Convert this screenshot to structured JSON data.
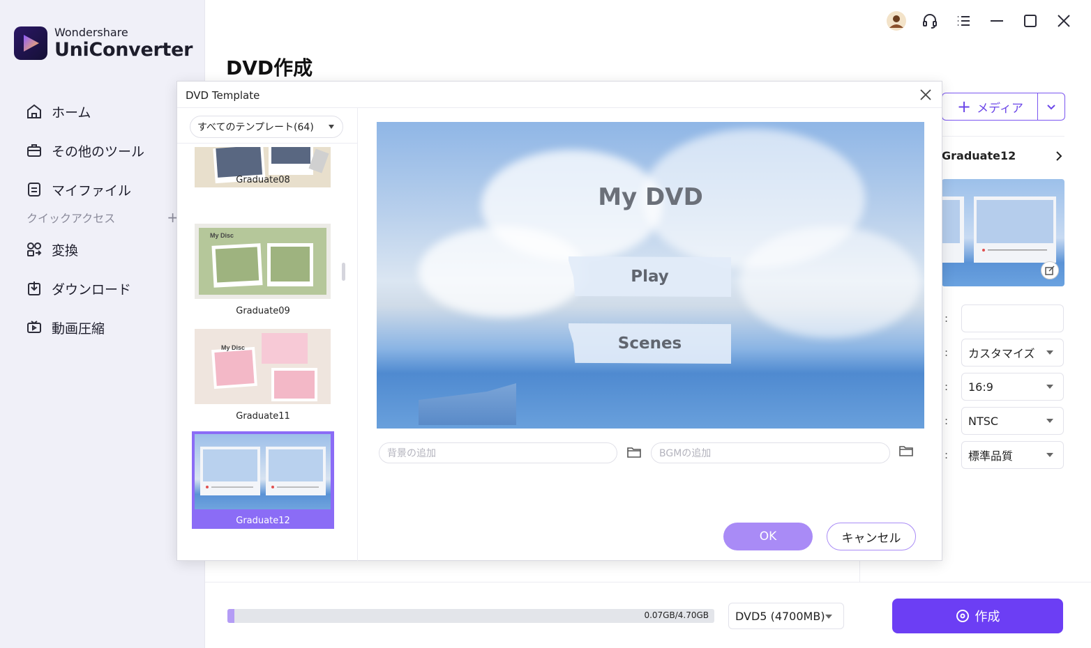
{
  "app": {
    "brand_small": "Wondershare",
    "brand_big": "UniConverter"
  },
  "sidebar": {
    "items": [
      {
        "label": "ホーム",
        "icon": "home-icon"
      },
      {
        "label": "その他のツール",
        "icon": "toolbox-icon"
      },
      {
        "label": "マイファイル",
        "icon": "file-icon"
      }
    ],
    "quick_access_label": "クイックアクセス",
    "quick_items": [
      {
        "label": "変換",
        "icon": "convert-icon"
      },
      {
        "label": "ダウンロード",
        "icon": "download-icon"
      },
      {
        "label": "動画圧縮",
        "icon": "compress-icon"
      }
    ]
  },
  "page": {
    "title": "DVD作成"
  },
  "right_panel": {
    "media_label": "メディア",
    "template_name": "Graduate12",
    "settings": [
      {
        "value": ""
      },
      {
        "value": "カスタマイズ"
      },
      {
        "value": "16:9"
      },
      {
        "value": "NTSC"
      },
      {
        "value": "標準品質"
      }
    ]
  },
  "bottom": {
    "storage_text": "0.07GB/4.70GB",
    "storage_fraction": 0.015,
    "disc_type": "DVD5 (4700MB)",
    "create_label": "作成"
  },
  "modal": {
    "title": "DVD Template",
    "filter_label": "すべてのテンプレート(64)",
    "templates": [
      {
        "name": "Graduate08",
        "selected": false,
        "thumb_text": ""
      },
      {
        "name": "Graduate09",
        "selected": false,
        "thumb_text": "My Disc"
      },
      {
        "name": "Graduate11",
        "selected": false,
        "thumb_text": "My Disc"
      },
      {
        "name": "Graduate12",
        "selected": true,
        "thumb_text": ""
      }
    ],
    "preview": {
      "title": "My DVD",
      "buttons": [
        "Play",
        "Scenes"
      ]
    },
    "bg_placeholder": "背景の追加",
    "bgm_placeholder": "BGMの追加",
    "ok_label": "OK",
    "cancel_label": "キャンセル"
  },
  "colors": {
    "accent": "#6c3ef4",
    "accent_light": "#a98bf6",
    "selected_bg": "#8b6cf6"
  }
}
